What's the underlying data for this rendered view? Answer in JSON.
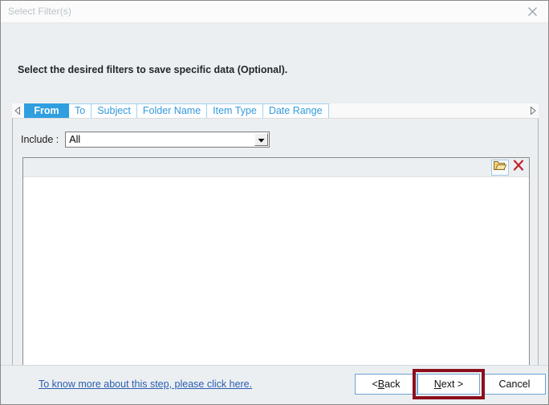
{
  "window": {
    "title": "Select Filter(s)",
    "close_icon": "close-icon"
  },
  "instruction": "Select the desired filters to save specific data (Optional).",
  "tabs": {
    "scroll_left_icon": "chevron-left-icon",
    "scroll_right_icon": "chevron-right-icon",
    "items": [
      {
        "label": "From",
        "active": true
      },
      {
        "label": "To",
        "active": false
      },
      {
        "label": "Subject",
        "active": false
      },
      {
        "label": "Folder Name",
        "active": false
      },
      {
        "label": "Item Type",
        "active": false
      },
      {
        "label": "Date Range",
        "active": false
      }
    ]
  },
  "filter_panel": {
    "include_label": "Include :",
    "include_value": "All",
    "include_placeholder": "All",
    "include_options": [
      "All"
    ],
    "toolbar": {
      "import_icon": "folder-open-icon",
      "delete_icon": "red-x-delete-icon"
    },
    "list_items": []
  },
  "footer": {
    "help_link": "To know more about this step, please click here.",
    "buttons": {
      "back": {
        "prefix": "< ",
        "accel": "B",
        "suffix": "ack"
      },
      "next": {
        "prefix": "",
        "accel": "N",
        "suffix": "ext >"
      },
      "cancel": {
        "prefix": "",
        "accel": "",
        "suffix": "Cancel"
      }
    }
  },
  "colors": {
    "tab_active_bg": "#2f9fe0",
    "tab_text": "#3399dd",
    "link": "#2a5db0",
    "highlight_border": "#8b0f1e",
    "panel_bg": "#eceff1"
  }
}
